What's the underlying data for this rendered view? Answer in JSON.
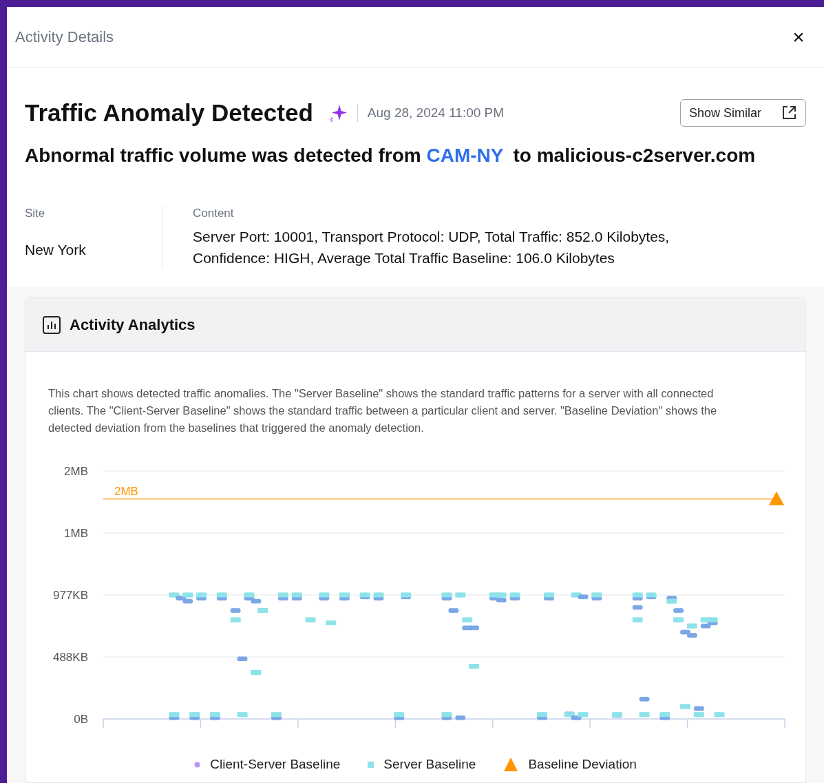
{
  "window": {
    "title": "Activity Details",
    "close": "×"
  },
  "alert": {
    "title": "Traffic Anomaly Detected",
    "timestamp": "Aug 28, 2024 11:00 PM",
    "show_similar": "Show Similar",
    "summary_before": "Abnormal traffic volume was detected from",
    "device": "CAM-NY",
    "summary_after": "to malicious-c2server.com"
  },
  "details": [
    {
      "label": "Site",
      "value": "New York"
    },
    {
      "label": "Content",
      "value": "Server Port: 10001, Transport Protocol: UDP, Total Traffic: 852.0 Kilobytes,\nConfidence: HIGH, Average Total Traffic Baseline: 106.0 Kilobytes"
    }
  ],
  "analytics": {
    "title": "Activity Analytics",
    "description": "This chart shows detected traffic anomalies. The \"Server Baseline\" shows the standard traffic patterns for a server with all connected clients. The \"Client-Server Baseline\" shows the standard traffic between a particular client and server. \"Baseline Deviation\" shows the detected deviation from the baselines that triggered the anomaly detection.",
    "y_axis_labels": [
      "2MB",
      "1MB",
      "977KB",
      "488KB",
      "0B"
    ],
    "threshold_label": "2MB",
    "legend": [
      {
        "kind": "dot",
        "label": "Client-Server Baseline",
        "color": "#b794f6"
      },
      {
        "kind": "square",
        "label": "Server Baseline",
        "color": "#8ee3ea"
      },
      {
        "kind": "triangle",
        "label": "Baseline Deviation",
        "color": "#ff9500"
      }
    ]
  }
}
